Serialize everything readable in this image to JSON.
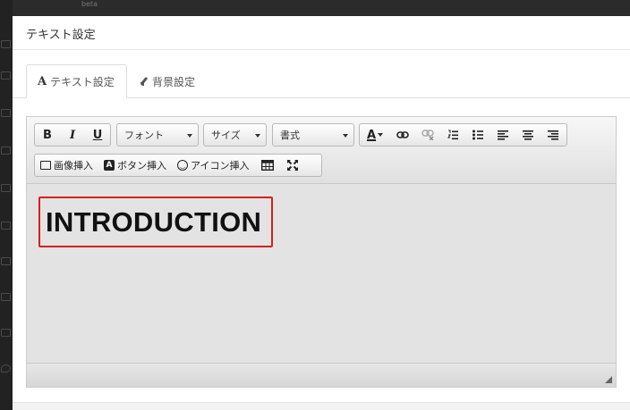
{
  "app": {
    "beta_label": "beta"
  },
  "modal": {
    "title": "テキスト設定"
  },
  "tabs": [
    {
      "icon": "A",
      "label": "テキスト設定",
      "active": true
    },
    {
      "icon": "brush-icon",
      "label": "背景設定",
      "active": false
    }
  ],
  "toolbar": {
    "bold": "B",
    "italic": "I",
    "underline": "U",
    "font_select": "フォント",
    "size_select": "サイズ",
    "format_select": "書式",
    "text_color": "A",
    "insert_image": "画像挿入",
    "insert_button_icon": "A",
    "insert_button": "ボタン挿入",
    "insert_icon": "アイコン挿入"
  },
  "editor": {
    "content_text": "INTRODUCTION"
  },
  "colors": {
    "highlight_border": "#d52020",
    "editor_bg": "#e3e3e3",
    "sidebar_bg": "#222222"
  }
}
